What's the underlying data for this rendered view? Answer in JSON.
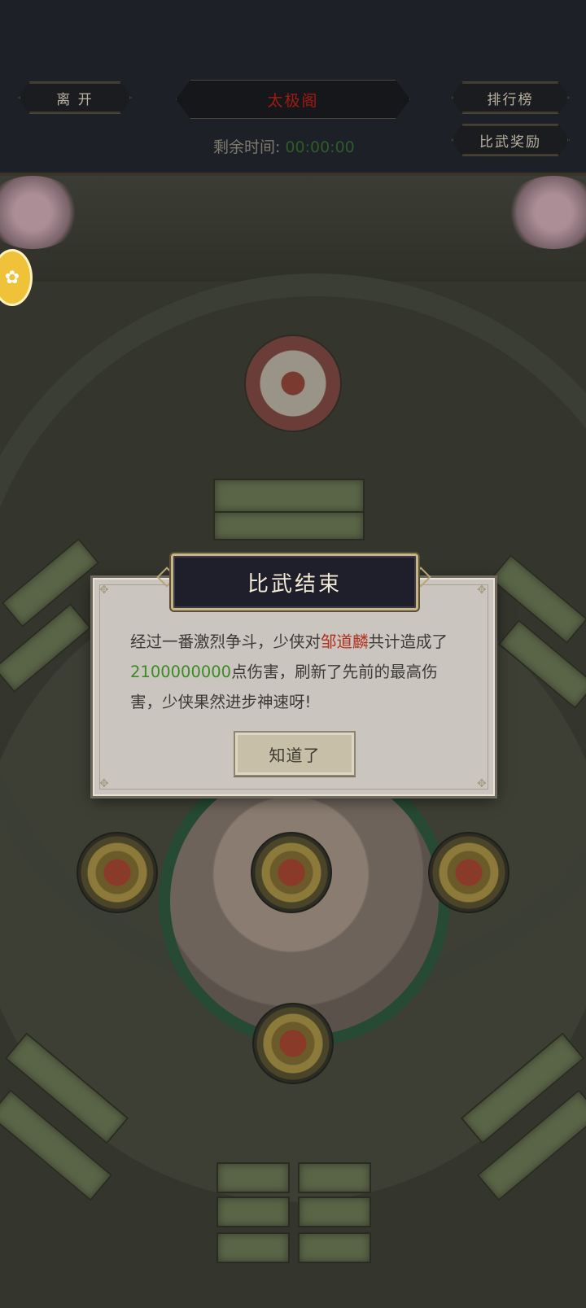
{
  "topbar": {
    "leave_label": "离 开",
    "title_label": "太极阁",
    "rank_label": "排行榜",
    "reward_label": "比武奖励",
    "timer_label": "剩余时间:",
    "timer_value": "00:00:00"
  },
  "dialog": {
    "title": "比武结束",
    "text_part1": "经过一番激烈争斗，少侠对",
    "enemy_name": "邹道麟",
    "text_part2": "共计造成了",
    "damage": "2100000000",
    "text_part3": "点伤害，刷新了先前的最高伤害，少侠果然进步神速呀!",
    "ok_label": "知道了"
  },
  "colors": {
    "enemy_name": "#b0311f",
    "damage": "#3b8a23",
    "title_red": "#a01a12",
    "dialog_bg": "#cbc5bf"
  }
}
